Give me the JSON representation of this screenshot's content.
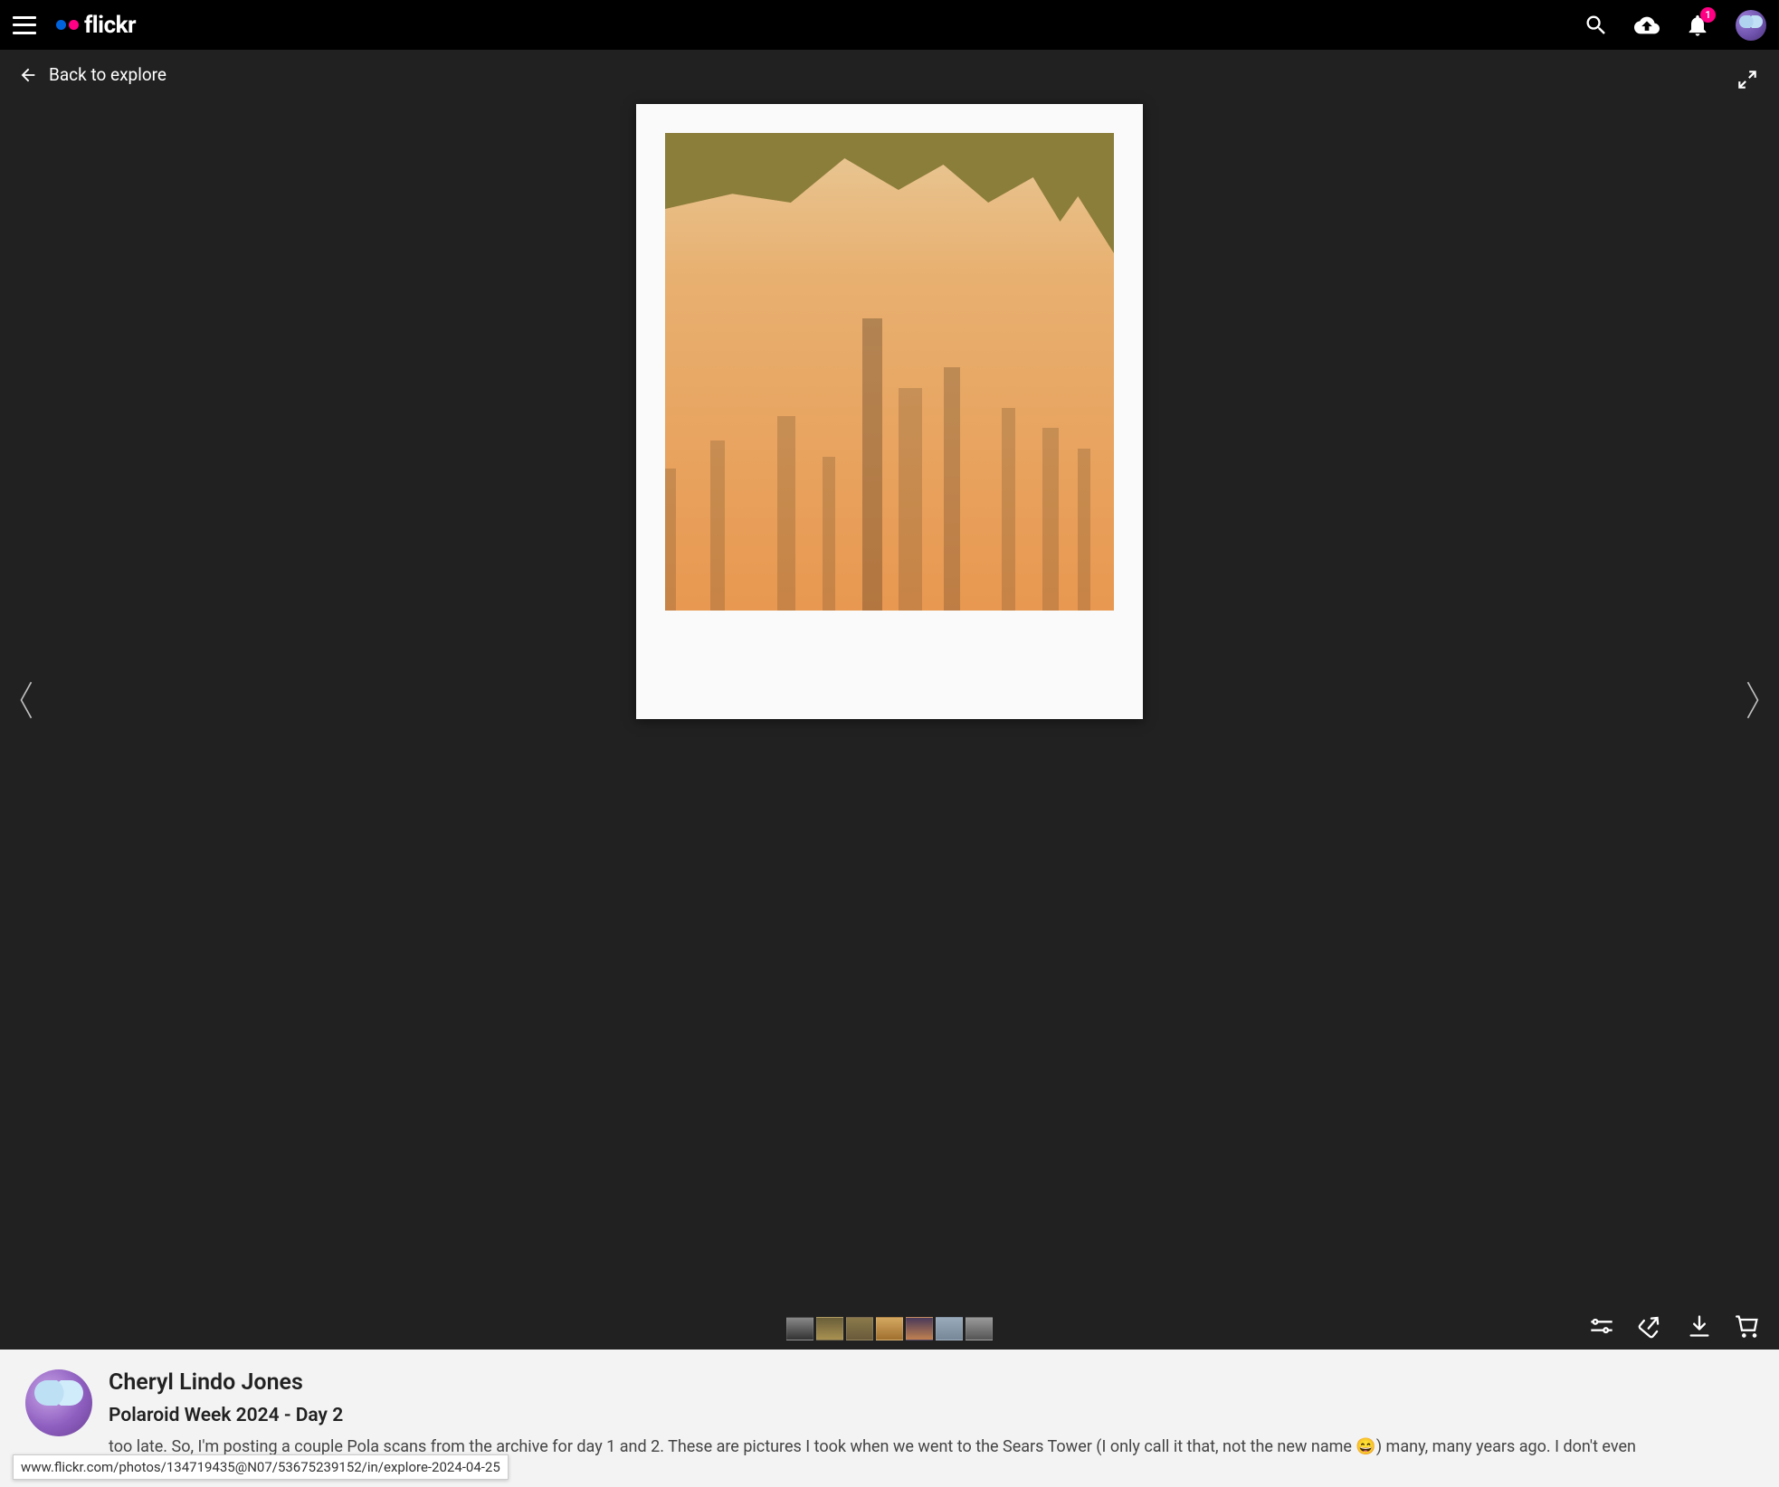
{
  "header": {
    "logo_text": "flickr",
    "notification_count": "1"
  },
  "nav": {
    "back_label": "Back to explore"
  },
  "actions": {
    "settings": "settings",
    "share": "share",
    "download": "download",
    "cart": "cart"
  },
  "info": {
    "author": "Cheryl Lindo Jones",
    "title": "Polaroid Week 2024 - Day 2",
    "description": "too late. So, I'm posting a couple Pola scans from the archive for day 1 and 2. These are pictures I took when we went to the Sears Tower (I only call it that, not the new name 😄) many, many years ago. I don't even"
  },
  "status_url": "www.flickr.com/photos/134719435@N07/53675239152/in/explore-2024-04-25"
}
